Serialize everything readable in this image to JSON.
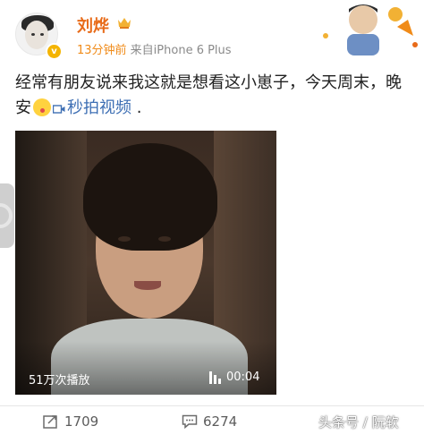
{
  "post": {
    "username": "刘烨",
    "time": "13分钟前",
    "source": " 来自iPhone 6 Plus",
    "text_main": "经常有朋友说来我这就是想看这小崽子，今天周末，晚安",
    "video_link": "秒拍视频",
    "text_end": " .",
    "verified_mark": "v"
  },
  "video": {
    "play_count": "51万次播放",
    "duration": "00:04"
  },
  "actions": {
    "repost_count": "1709",
    "comment_count": "6274"
  },
  "watermark": "头条号 / 阮软",
  "colors": {
    "username": "#e86b19",
    "time": "#f08b19",
    "link": "#3e6fb4"
  }
}
